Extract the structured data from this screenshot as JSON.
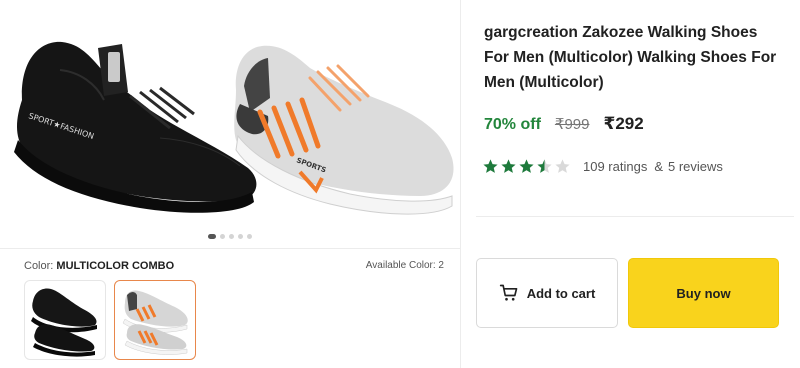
{
  "product": {
    "title": "gargcreation Zakozee Walking Shoes For Men (Multicolor) Walking Shoes For Men (Multicolor)",
    "discount": "70% off",
    "mrp": "₹999",
    "price": "₹292",
    "rating_value": 3.5,
    "ratings_count": "109 ratings",
    "reviews_sep": "&",
    "reviews_count": "5 reviews"
  },
  "gallery": {
    "dot_count": 5,
    "active_index": 0,
    "shoe_text_black": "SPORT★FASHION",
    "shoe_text_grey": "SPORTS"
  },
  "color": {
    "label": "Color:",
    "value": "MULTICOLOR COMBO",
    "available": "Available Color: 2"
  },
  "actions": {
    "add_to_cart": "Add to cart",
    "buy_now": "Buy now"
  },
  "colors": {
    "discount_green": "#23863c",
    "star_green": "#1e7a3c",
    "buy_yellow": "#f9d31c",
    "accent_orange": "#e8874b"
  },
  "icons": {
    "cart": "cart-icon",
    "star": "star-icon"
  }
}
